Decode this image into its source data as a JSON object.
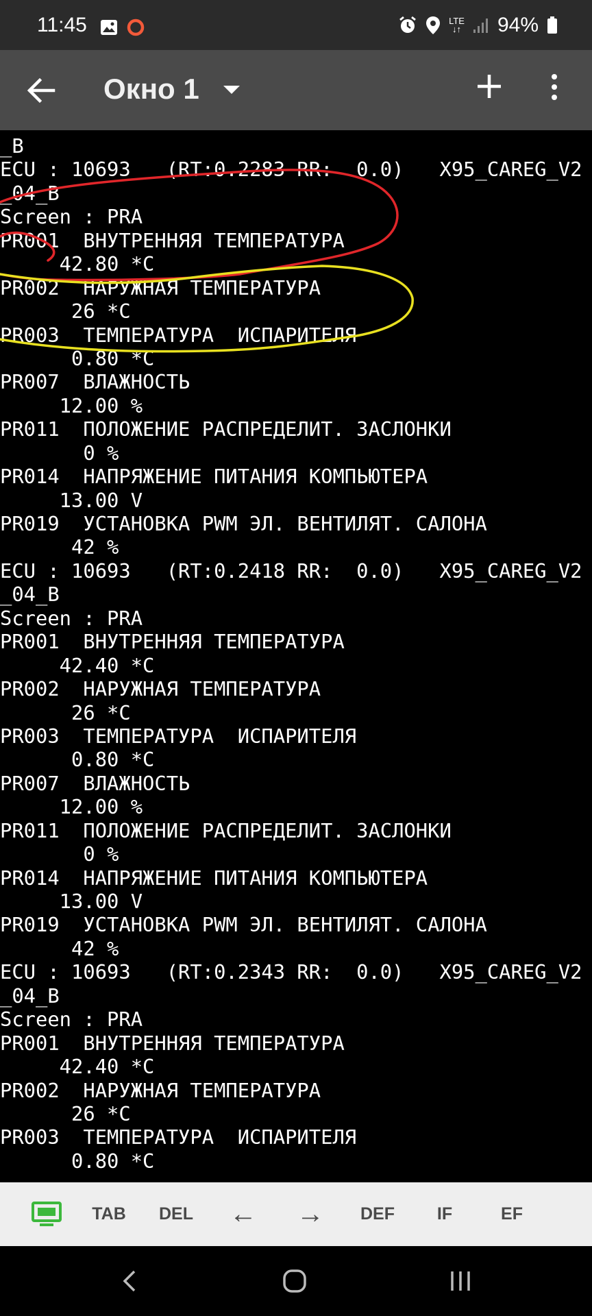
{
  "status_bar": {
    "time": "11:45",
    "left_icons": [
      "gallery-icon",
      "record-circle-icon"
    ],
    "right_icons": [
      "alarm-icon",
      "location-icon",
      "lte-icon",
      "signal-icon",
      "battery-icon"
    ],
    "lte_label": "LTE",
    "battery": "94%"
  },
  "app_bar": {
    "title": "Окно 1",
    "icons": [
      "back-arrow-icon",
      "dropdown-caret-icon",
      "plus-icon",
      "more-vert-icon"
    ]
  },
  "terminal": {
    "lines": [
      "_B",
      "ECU : 10693   (RT:0.2283 RR:  0.0)   X95_CAREG_V2",
      "_04_B",
      "Screen : PRA",
      "PR001  ВНУТРЕННЯЯ ТЕМПЕРАТУРА",
      "     42.80 *C",
      "PR002  НАРУЖНАЯ ТЕМПЕРАТУРА",
      "      26 *C",
      "PR003  ТЕМПЕРАТУРА  ИСПАРИТЕЛЯ",
      "      0.80 *C",
      "PR007  ВЛАЖНОСТЬ",
      "     12.00 %",
      "PR011  ПОЛОЖЕНИЕ РАСПРЕДЕЛИТ. ЗАСЛОНКИ",
      "       0 %",
      "PR014  НАПРЯЖЕНИЕ ПИТАНИЯ КОМПЬЮТЕРА",
      "     13.00 V",
      "PR019  УСТАНОВКА PWM ЭЛ. ВЕНТИЛЯТ. САЛОНА",
      "      42 %",
      "ECU : 10693   (RT:0.2418 RR:  0.0)   X95_CAREG_V2",
      "_04_B",
      "Screen : PRA",
      "PR001  ВНУТРЕННЯЯ ТЕМПЕРАТУРА",
      "     42.40 *C",
      "PR002  НАРУЖНАЯ ТЕМПЕРАТУРА",
      "      26 *C",
      "PR003  ТЕМПЕРАТУРА  ИСПАРИТЕЛЯ",
      "      0.80 *C",
      "PR007  ВЛАЖНОСТЬ",
      "     12.00 %",
      "PR011  ПОЛОЖЕНИЕ РАСПРЕДЕЛИТ. ЗАСЛОНКИ",
      "       0 %",
      "PR014  НАПРЯЖЕНИЕ ПИТАНИЯ КОМПЬЮТЕРА",
      "     13.00 V",
      "PR019  УСТАНОВКА PWM ЭЛ. ВЕНТИЛЯТ. САЛОНА",
      "      42 %",
      "ECU : 10693   (RT:0.2343 RR:  0.0)   X95_CAREG_V2",
      "_04_B",
      "Screen : PRA",
      "PR001  ВНУТРЕННЯЯ ТЕМПЕРАТУРА",
      "     42.40 *C",
      "PR002  НАРУЖНАЯ ТЕМПЕРАТУРА",
      "      26 *C",
      "PR003  ТЕМПЕРАТУРА  ИСПАРИТЕЛЯ",
      "      0.80 *C"
    ],
    "annotations": [
      {
        "name": "red-hand-drawn-ellipse",
        "color": "#e0262a"
      },
      {
        "name": "yellow-hand-drawn-ellipse",
        "color": "#e8e020"
      }
    ]
  },
  "key_bar": {
    "keyboard_icon": "keyboard-icon",
    "keys": [
      "TAB",
      "DEL",
      "←",
      "→",
      "DEF",
      "IF",
      "EF"
    ],
    "accent_color": "#3cb83c"
  },
  "nav_bar": {
    "icons": [
      "nav-back-icon",
      "nav-home-icon",
      "nav-recents-icon"
    ]
  }
}
